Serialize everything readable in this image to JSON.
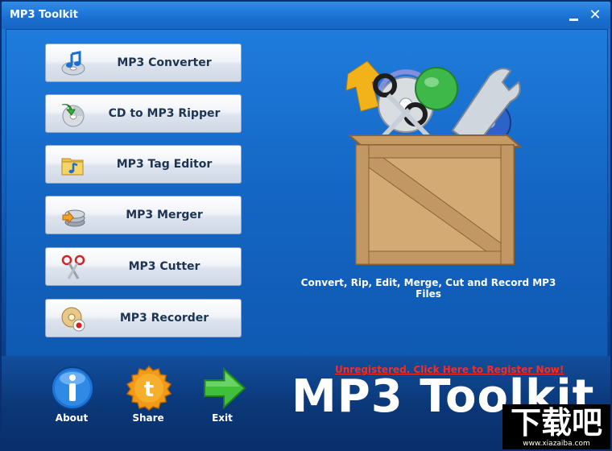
{
  "window": {
    "title": "MP3 Toolkit"
  },
  "tools": [
    {
      "label": "MP3 Converter",
      "icon": "music-note-disc-icon"
    },
    {
      "label": "CD to MP3 Ripper",
      "icon": "cd-rip-icon"
    },
    {
      "label": "MP3 Tag Editor",
      "icon": "folder-note-icon"
    },
    {
      "label": "MP3 Merger",
      "icon": "disc-stack-icon"
    },
    {
      "label": "MP3 Cutter",
      "icon": "scissors-icon"
    },
    {
      "label": "MP3 Recorder",
      "icon": "record-disc-icon"
    }
  ],
  "tagline": "Convert, Rip, Edit, Merge, Cut and Record MP3 Files",
  "bottom": {
    "about_label": "About",
    "share_label": "Share",
    "exit_label": "Exit",
    "register_link": "Unregistered. Click Here to Register Now!",
    "brand": "MP3 Toolkit"
  },
  "watermark": {
    "text": "下载吧",
    "url": "www.xiazaiba.com"
  },
  "colors": {
    "accent": "#1466c4",
    "register": "#ff2a1a",
    "button_text": "#1d3552"
  }
}
